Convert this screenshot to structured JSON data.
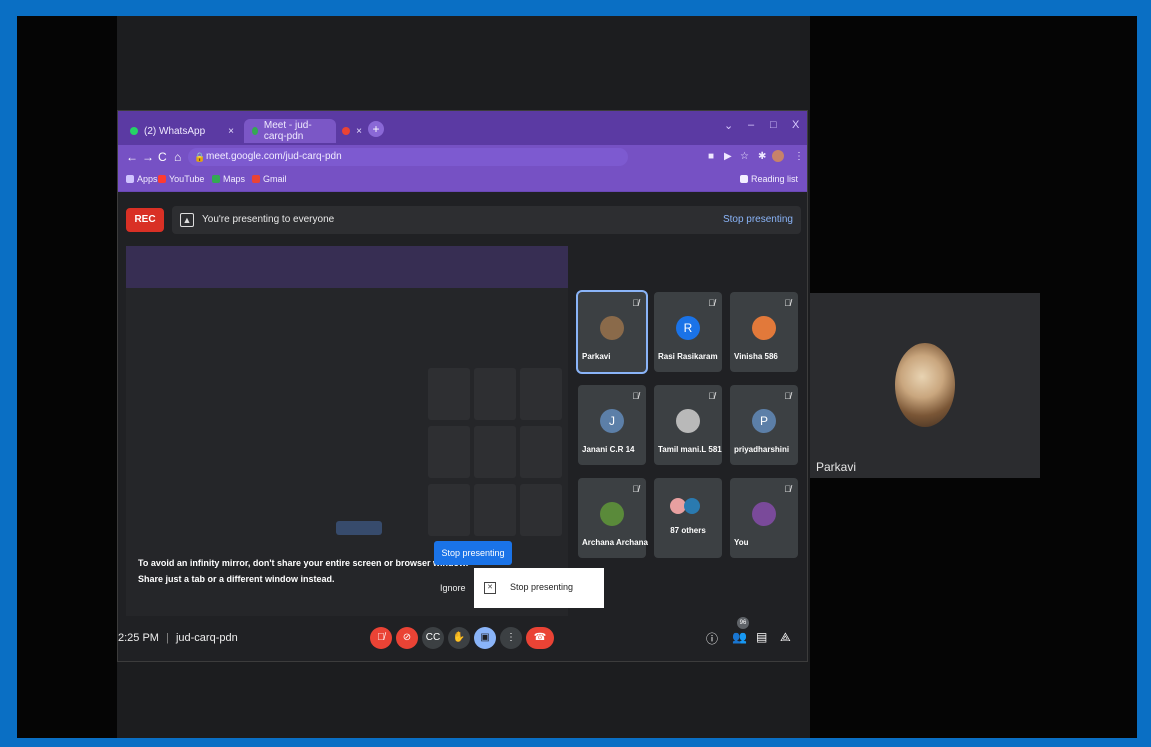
{
  "browser": {
    "tabs": [
      {
        "label": "(2) WhatsApp",
        "close": "×"
      },
      {
        "label": "Meet - jud-carq-pdn",
        "close": "×"
      },
      {
        "label": "",
        "close": "×"
      }
    ],
    "new_tab": "+",
    "window_controls": {
      "chevron": "⌄",
      "minimize": "–",
      "maximize": "□",
      "close": "X"
    },
    "nav": {
      "back": "←",
      "forward": "→",
      "reload": "C",
      "home": "⌂"
    },
    "url": "meet.google.com/jud-carq-pdn",
    "bookmarks": [
      {
        "label": "Apps",
        "color": "#d0c4ff"
      },
      {
        "label": "YouTube",
        "color": "#ff3b30"
      },
      {
        "label": "Maps",
        "color": "#34a853"
      },
      {
        "label": "Gmail",
        "color": "#ea4335"
      }
    ],
    "reading_list": "Reading list"
  },
  "meet": {
    "rec_label": "REC",
    "presenting_text": "You're presenting to everyone",
    "stop_presenting_link": "Stop presenting",
    "participants": [
      {
        "name": "Parkavi",
        "initial": "",
        "avatar_color": "#8a6a4a",
        "selected": true
      },
      {
        "name": "Rasi Rasikaram",
        "initial": "R",
        "avatar_color": "#1a73e8",
        "selected": false
      },
      {
        "name": "Vinisha 586",
        "initial": "",
        "avatar_color": "#e2793a",
        "selected": false
      },
      {
        "name": "Janani C.R 14",
        "initial": "J",
        "avatar_color": "#5c7fa8",
        "selected": false
      },
      {
        "name": "Tamil mani.L 581",
        "initial": "",
        "avatar_color": "#b9b9b9",
        "selected": false
      },
      {
        "name": "priyadharshini",
        "initial": "P",
        "avatar_color": "#5c7fa8",
        "selected": false
      },
      {
        "name": "Archana Archana",
        "initial": "",
        "avatar_color": "#5a8a3a",
        "selected": false
      },
      {
        "name": "87 others",
        "initial": "",
        "avatar_color": "#2a7ab0",
        "selected": false
      },
      {
        "name": "You",
        "initial": "",
        "avatar_color": "#7a4a9a",
        "selected": false
      }
    ],
    "warning_line1": "To avoid an infinity mirror, don't share your entire screen or browser window.",
    "warning_line2": "Share just a tab or a different window instead.",
    "stop_presenting_button": "Stop presenting",
    "ignore_button": "Ignore",
    "popup_text": "Stop presenting",
    "time": "2:25 PM",
    "separator": "|",
    "meeting_code": "jud-carq-pdn",
    "people_count": "96"
  },
  "self_view": {
    "name": "Parkavi"
  }
}
